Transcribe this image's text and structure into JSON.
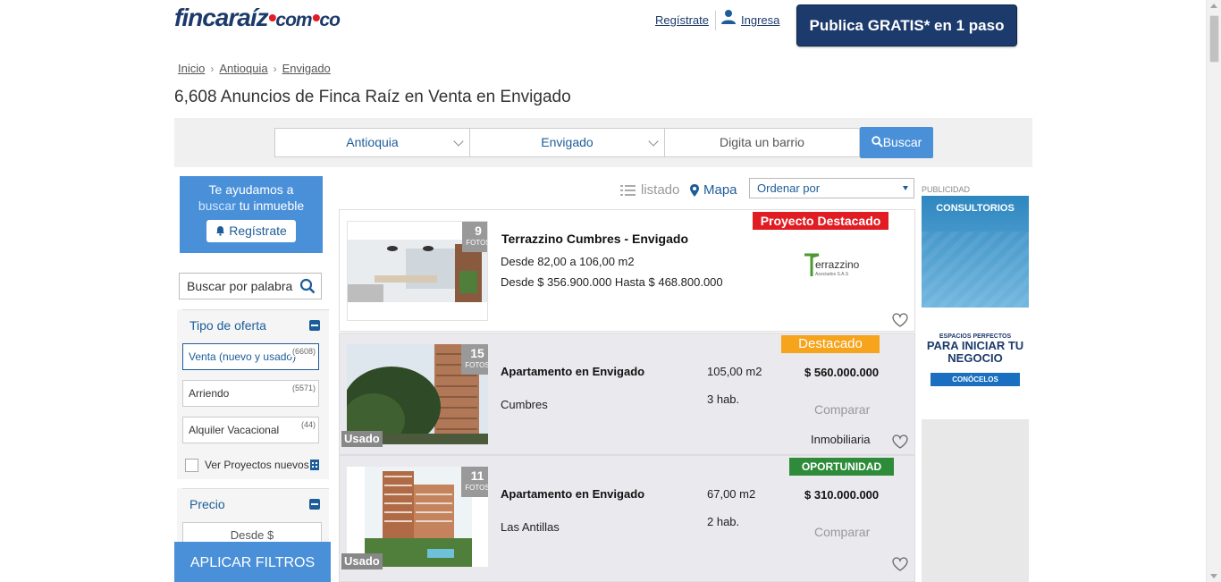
{
  "header": {
    "logo_main": "fincaraíz",
    "logo_dom": "com",
    "logo_tld": "co",
    "register_link": "Regístrate",
    "login_link": "Ingresa",
    "publish_button": "Publica GRATIS* en 1 paso"
  },
  "breadcrumb": [
    "Inicio",
    "Antioquia",
    "Envigado"
  ],
  "page_title": "6,608 Anuncios de Finca Raíz en Venta en Envigado",
  "search": {
    "department": "Antioquia",
    "city": "Envigado",
    "neighborhood_placeholder": "Digita un barrio",
    "search_button": "Buscar"
  },
  "sidebar": {
    "help_line1": "Te ayudamos a",
    "help_highlight": "buscar",
    "help_line2_rest": " tu inmueble",
    "register_button": "Regístrate",
    "keyword_search_placeholder": "Buscar por palabra",
    "offer_type_title": "Tipo de oferta",
    "offer_options": [
      {
        "label": "Venta (nuevo y usado)",
        "count": "(6608)"
      },
      {
        "label": "Arriendo",
        "count": "(5571)"
      },
      {
        "label": "Alquiler Vacacional",
        "count": "(44)"
      }
    ],
    "projects_checkbox": "Ver Proyectos nuevos",
    "price_title": "Precio",
    "price_from_placeholder": "Desde $",
    "apply_button": "APLICAR FILTROS"
  },
  "toolbar": {
    "list_label": "listado",
    "map_label": "Mapa",
    "order_label": "Ordenar por"
  },
  "listings": [
    {
      "ribbon": "Proyecto Destacado",
      "photos": "9",
      "photos_label": "FOTOS",
      "title": "Terrazzino Cumbres - Envigado",
      "area": "Desde 82,00 a 106,00 m2",
      "price_range": "Desde $ 356.900.000 Hasta $ 468.800.000",
      "brand": "errazzino",
      "brand_sub": "Asociados S.A.S"
    },
    {
      "ribbon": "Destacado",
      "photos": "15",
      "photos_label": "FOTOS",
      "condition": "Usado",
      "title": "Apartamento en Envigado",
      "area": "105,00 m2",
      "price": "$ 560.000.000",
      "neighborhood": "Cumbres",
      "rooms": "3 hab.",
      "compare": "Comparar",
      "seller": "Inmobiliaria"
    },
    {
      "ribbon": "OPORTUNIDAD",
      "photos": "11",
      "photos_label": "FOTOS",
      "condition": "Usado",
      "title": "Apartamento en Envigado",
      "area": "67,00 m2",
      "price": "$ 310.000.000",
      "neighborhood": "Las Antillas",
      "rooms": "2 hab.",
      "compare": "Comparar"
    }
  ],
  "ads": {
    "label": "PUBLICIDAD",
    "ad1_title": "CONSULTORIOS",
    "ad1_small": "ESPACIOS PERFECTOS",
    "ad1_big": "PARA INICIAR TU NEGOCIO",
    "ad1_cta": "CONÓCELOS"
  },
  "colors": {
    "brand_navy": "#1c3a6b",
    "accent_blue": "#4a90d9",
    "ribbon_red": "#e11c22",
    "ribbon_orange": "#f5a41b",
    "ribbon_green": "#2e8b3a"
  }
}
